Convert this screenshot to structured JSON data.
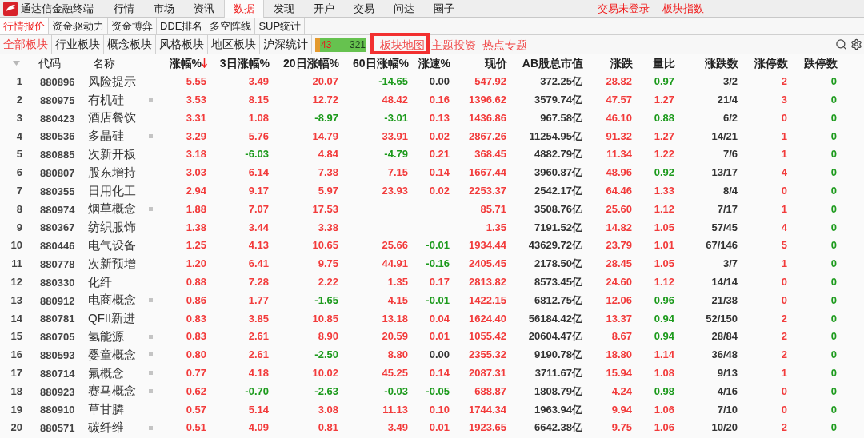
{
  "app": {
    "title": "通达信金融终端"
  },
  "menu": [
    {
      "label": "行情",
      "selected": false
    },
    {
      "label": "市场",
      "selected": false
    },
    {
      "label": "资讯",
      "selected": false
    },
    {
      "label": "数据",
      "selected": true
    },
    {
      "label": "发现",
      "selected": false
    },
    {
      "label": "开户",
      "selected": false
    },
    {
      "label": "交易",
      "selected": false
    },
    {
      "label": "问达",
      "selected": false
    },
    {
      "label": "圈子",
      "selected": false
    }
  ],
  "status_links": [
    "交易未登录",
    "板块指数"
  ],
  "sub_tabs": [
    {
      "label": "行情报价",
      "selected": true
    },
    {
      "label": "资金驱动力",
      "selected": false
    },
    {
      "label": "资金博弈",
      "selected": false
    },
    {
      "label": "DDE排名",
      "selected": false
    },
    {
      "label": "多空阵线",
      "selected": false
    },
    {
      "label": "SUP统计",
      "selected": false
    }
  ],
  "sector_tabs": [
    {
      "label": "全部板块",
      "selected": true
    },
    {
      "label": "行业板块",
      "selected": false
    },
    {
      "label": "概念板块",
      "selected": false
    },
    {
      "label": "风格板块",
      "selected": false
    },
    {
      "label": "地区板块",
      "selected": false
    },
    {
      "label": "沪深统计",
      "selected": false
    }
  ],
  "breadth_bar": {
    "left_count": "43",
    "right_count": "321",
    "level": 0.1
  },
  "feature_links": [
    {
      "label": "板块地图",
      "highlighted": true
    },
    {
      "label": "主题投资",
      "highlighted": false
    },
    {
      "label": "热点专题",
      "highlighted": false
    }
  ],
  "table": {
    "columns": [
      {
        "label": "代码",
        "kind": "code",
        "sorted": false
      },
      {
        "label": "名称",
        "kind": "name",
        "sorted": false
      },
      {
        "label": "涨幅%",
        "kind": "number",
        "sorted": true
      },
      {
        "label": "3日涨幅%",
        "kind": "number",
        "sorted": false
      },
      {
        "label": "20日涨幅%",
        "kind": "number",
        "sorted": false
      },
      {
        "label": "60日涨幅%",
        "kind": "number",
        "sorted": false
      },
      {
        "label": "涨速%",
        "kind": "number",
        "sorted": false
      },
      {
        "label": "现价",
        "kind": "number",
        "sorted": false
      },
      {
        "label": "AB股总市值",
        "kind": "number",
        "sorted": false
      },
      {
        "label": "涨跌",
        "kind": "number",
        "sorted": false
      },
      {
        "label": "量比",
        "kind": "number",
        "sorted": false
      },
      {
        "label": "涨跌数",
        "kind": "number",
        "sorted": false
      },
      {
        "label": "涨停数",
        "kind": "number",
        "sorted": false
      },
      {
        "label": "跌停数",
        "kind": "number",
        "sorted": false
      }
    ],
    "rows": [
      {
        "index": "1",
        "marked": false,
        "cells": [
          {
            "text": "880896"
          },
          {
            "text": "风险提示"
          },
          {
            "text": "5.55",
            "color": "#f23b3b"
          },
          {
            "text": "3.49",
            "color": "#f23b3b"
          },
          {
            "text": "20.07",
            "color": "#f23b3b"
          },
          {
            "text": "-14.65",
            "color": "#1c9a1c"
          },
          {
            "text": "0.00",
            "color": "#333333"
          },
          {
            "text": "547.92",
            "color": "#f23b3b"
          },
          {
            "text": "372.25亿",
            "color": "#333333"
          },
          {
            "text": "28.82",
            "color": "#f23b3b"
          },
          {
            "text": "0.97",
            "color": "#1c9a1c"
          },
          {
            "text": "3/2",
            "color": "#333333"
          },
          {
            "text": "2",
            "color": "#f23b3b"
          },
          {
            "text": "0",
            "color": "#1c9a1c"
          }
        ]
      },
      {
        "index": "2",
        "marked": true,
        "cells": [
          {
            "text": "880975"
          },
          {
            "text": "有机硅"
          },
          {
            "text": "3.53",
            "color": "#f23b3b"
          },
          {
            "text": "8.15",
            "color": "#f23b3b"
          },
          {
            "text": "12.72",
            "color": "#f23b3b"
          },
          {
            "text": "48.42",
            "color": "#f23b3b"
          },
          {
            "text": "0.16",
            "color": "#f23b3b"
          },
          {
            "text": "1396.62",
            "color": "#f23b3b"
          },
          {
            "text": "3579.74亿",
            "color": "#333333"
          },
          {
            "text": "47.57",
            "color": "#f23b3b"
          },
          {
            "text": "1.27",
            "color": "#f23b3b"
          },
          {
            "text": "21/4",
            "color": "#333333"
          },
          {
            "text": "3",
            "color": "#f23b3b"
          },
          {
            "text": "0",
            "color": "#1c9a1c"
          }
        ]
      },
      {
        "index": "3",
        "marked": false,
        "cells": [
          {
            "text": "880423"
          },
          {
            "text": "酒店餐饮"
          },
          {
            "text": "3.31",
            "color": "#f23b3b"
          },
          {
            "text": "1.08",
            "color": "#f23b3b"
          },
          {
            "text": "-8.97",
            "color": "#1c9a1c"
          },
          {
            "text": "-3.01",
            "color": "#1c9a1c"
          },
          {
            "text": "0.13",
            "color": "#f23b3b"
          },
          {
            "text": "1436.86",
            "color": "#f23b3b"
          },
          {
            "text": "967.58亿",
            "color": "#333333"
          },
          {
            "text": "46.10",
            "color": "#f23b3b"
          },
          {
            "text": "0.88",
            "color": "#1c9a1c"
          },
          {
            "text": "6/2",
            "color": "#333333"
          },
          {
            "text": "0",
            "color": "#f23b3b"
          },
          {
            "text": "0",
            "color": "#1c9a1c"
          }
        ]
      },
      {
        "index": "4",
        "marked": true,
        "cells": [
          {
            "text": "880536"
          },
          {
            "text": "多晶硅"
          },
          {
            "text": "3.29",
            "color": "#f23b3b"
          },
          {
            "text": "5.76",
            "color": "#f23b3b"
          },
          {
            "text": "14.79",
            "color": "#f23b3b"
          },
          {
            "text": "33.91",
            "color": "#f23b3b"
          },
          {
            "text": "0.02",
            "color": "#f23b3b"
          },
          {
            "text": "2867.26",
            "color": "#f23b3b"
          },
          {
            "text": "11254.95亿",
            "color": "#333333"
          },
          {
            "text": "91.32",
            "color": "#f23b3b"
          },
          {
            "text": "1.27",
            "color": "#f23b3b"
          },
          {
            "text": "14/21",
            "color": "#333333"
          },
          {
            "text": "1",
            "color": "#f23b3b"
          },
          {
            "text": "0",
            "color": "#1c9a1c"
          }
        ]
      },
      {
        "index": "5",
        "marked": false,
        "cells": [
          {
            "text": "880885"
          },
          {
            "text": "次新开板"
          },
          {
            "text": "3.18",
            "color": "#f23b3b"
          },
          {
            "text": "-6.03",
            "color": "#1c9a1c"
          },
          {
            "text": "4.84",
            "color": "#f23b3b"
          },
          {
            "text": "-4.79",
            "color": "#1c9a1c"
          },
          {
            "text": "0.21",
            "color": "#f23b3b"
          },
          {
            "text": "368.45",
            "color": "#f23b3b"
          },
          {
            "text": "4882.79亿",
            "color": "#333333"
          },
          {
            "text": "11.34",
            "color": "#f23b3b"
          },
          {
            "text": "1.22",
            "color": "#f23b3b"
          },
          {
            "text": "7/6",
            "color": "#333333"
          },
          {
            "text": "1",
            "color": "#f23b3b"
          },
          {
            "text": "0",
            "color": "#1c9a1c"
          }
        ]
      },
      {
        "index": "6",
        "marked": false,
        "cells": [
          {
            "text": "880807"
          },
          {
            "text": "股东增持"
          },
          {
            "text": "3.03",
            "color": "#f23b3b"
          },
          {
            "text": "6.14",
            "color": "#f23b3b"
          },
          {
            "text": "7.38",
            "color": "#f23b3b"
          },
          {
            "text": "7.15",
            "color": "#f23b3b"
          },
          {
            "text": "0.14",
            "color": "#f23b3b"
          },
          {
            "text": "1667.44",
            "color": "#f23b3b"
          },
          {
            "text": "3960.87亿",
            "color": "#333333"
          },
          {
            "text": "48.96",
            "color": "#f23b3b"
          },
          {
            "text": "0.92",
            "color": "#1c9a1c"
          },
          {
            "text": "13/17",
            "color": "#333333"
          },
          {
            "text": "4",
            "color": "#f23b3b"
          },
          {
            "text": "0",
            "color": "#1c9a1c"
          }
        ]
      },
      {
        "index": "7",
        "marked": false,
        "cells": [
          {
            "text": "880355"
          },
          {
            "text": "日用化工"
          },
          {
            "text": "2.94",
            "color": "#f23b3b"
          },
          {
            "text": "9.17",
            "color": "#f23b3b"
          },
          {
            "text": "5.97",
            "color": "#f23b3b"
          },
          {
            "text": "23.93",
            "color": "#f23b3b"
          },
          {
            "text": "0.02",
            "color": "#f23b3b"
          },
          {
            "text": "2253.37",
            "color": "#f23b3b"
          },
          {
            "text": "2542.17亿",
            "color": "#333333"
          },
          {
            "text": "64.46",
            "color": "#f23b3b"
          },
          {
            "text": "1.33",
            "color": "#f23b3b"
          },
          {
            "text": "8/4",
            "color": "#333333"
          },
          {
            "text": "0",
            "color": "#f23b3b"
          },
          {
            "text": "0",
            "color": "#1c9a1c"
          }
        ]
      },
      {
        "index": "8",
        "marked": true,
        "cells": [
          {
            "text": "880974"
          },
          {
            "text": "烟草概念"
          },
          {
            "text": "1.88",
            "color": "#f23b3b"
          },
          {
            "text": "7.07",
            "color": "#f23b3b"
          },
          {
            "text": "17.53",
            "color": "#f23b3b"
          },
          null,
          null,
          {
            "text": "85.71",
            "color": "#f23b3b"
          },
          {
            "text": "3508.76亿",
            "color": "#333333"
          },
          {
            "text": "25.60",
            "color": "#f23b3b"
          },
          {
            "text": "1.12",
            "color": "#f23b3b"
          },
          {
            "text": "7/17",
            "color": "#333333"
          },
          {
            "text": "1",
            "color": "#f23b3b"
          },
          {
            "text": "0",
            "color": "#1c9a1c"
          }
        ]
      },
      {
        "index": "9",
        "marked": false,
        "cells": [
          {
            "text": "880367"
          },
          {
            "text": "纺织服饰"
          },
          {
            "text": "1.38",
            "color": "#f23b3b"
          },
          {
            "text": "3.44",
            "color": "#f23b3b"
          },
          {
            "text": "3.38",
            "color": "#f23b3b"
          },
          null,
          null,
          {
            "text": "1.35",
            "color": "#f23b3b"
          },
          {
            "text": "7191.52亿",
            "color": "#333333"
          },
          {
            "text": "14.82",
            "color": "#f23b3b"
          },
          {
            "text": "1.05",
            "color": "#f23b3b"
          },
          {
            "text": "57/45",
            "color": "#333333"
          },
          {
            "text": "4",
            "color": "#f23b3b"
          },
          {
            "text": "0",
            "color": "#1c9a1c"
          }
        ]
      },
      {
        "index": "10",
        "marked": false,
        "cells": [
          {
            "text": "880446"
          },
          {
            "text": "电气设备"
          },
          {
            "text": "1.25",
            "color": "#f23b3b"
          },
          {
            "text": "4.13",
            "color": "#f23b3b"
          },
          {
            "text": "10.65",
            "color": "#f23b3b"
          },
          {
            "text": "25.66",
            "color": "#f23b3b"
          },
          {
            "text": "-0.01",
            "color": "#1c9a1c"
          },
          {
            "text": "1934.44",
            "color": "#f23b3b"
          },
          {
            "text": "43629.72亿",
            "color": "#333333"
          },
          {
            "text": "23.79",
            "color": "#f23b3b"
          },
          {
            "text": "1.01",
            "color": "#f23b3b"
          },
          {
            "text": "67/146",
            "color": "#333333"
          },
          {
            "text": "5",
            "color": "#f23b3b"
          },
          {
            "text": "0",
            "color": "#1c9a1c"
          }
        ]
      },
      {
        "index": "11",
        "marked": false,
        "cells": [
          {
            "text": "880778"
          },
          {
            "text": "次新预增"
          },
          {
            "text": "1.20",
            "color": "#f23b3b"
          },
          {
            "text": "6.41",
            "color": "#f23b3b"
          },
          {
            "text": "9.75",
            "color": "#f23b3b"
          },
          {
            "text": "44.91",
            "color": "#f23b3b"
          },
          {
            "text": "-0.16",
            "color": "#1c9a1c"
          },
          {
            "text": "2405.45",
            "color": "#f23b3b"
          },
          {
            "text": "2178.50亿",
            "color": "#333333"
          },
          {
            "text": "28.45",
            "color": "#f23b3b"
          },
          {
            "text": "1.05",
            "color": "#f23b3b"
          },
          {
            "text": "3/7",
            "color": "#333333"
          },
          {
            "text": "1",
            "color": "#f23b3b"
          },
          {
            "text": "0",
            "color": "#1c9a1c"
          }
        ]
      },
      {
        "index": "12",
        "marked": false,
        "cells": [
          {
            "text": "880330"
          },
          {
            "text": "化纤"
          },
          {
            "text": "0.88",
            "color": "#f23b3b"
          },
          {
            "text": "7.28",
            "color": "#f23b3b"
          },
          {
            "text": "2.22",
            "color": "#f23b3b"
          },
          {
            "text": "1.35",
            "color": "#f23b3b"
          },
          {
            "text": "0.17",
            "color": "#f23b3b"
          },
          {
            "text": "2813.82",
            "color": "#f23b3b"
          },
          {
            "text": "8573.45亿",
            "color": "#333333"
          },
          {
            "text": "24.60",
            "color": "#f23b3b"
          },
          {
            "text": "1.12",
            "color": "#f23b3b"
          },
          {
            "text": "14/14",
            "color": "#333333"
          },
          {
            "text": "0",
            "color": "#f23b3b"
          },
          {
            "text": "0",
            "color": "#1c9a1c"
          }
        ]
      },
      {
        "index": "13",
        "marked": true,
        "cells": [
          {
            "text": "880912"
          },
          {
            "text": "电商概念"
          },
          {
            "text": "0.86",
            "color": "#f23b3b"
          },
          {
            "text": "1.77",
            "color": "#f23b3b"
          },
          {
            "text": "-1.65",
            "color": "#1c9a1c"
          },
          {
            "text": "4.15",
            "color": "#f23b3b"
          },
          {
            "text": "-0.01",
            "color": "#1c9a1c"
          },
          {
            "text": "1422.15",
            "color": "#f23b3b"
          },
          {
            "text": "6812.75亿",
            "color": "#333333"
          },
          {
            "text": "12.06",
            "color": "#f23b3b"
          },
          {
            "text": "0.96",
            "color": "#1c9a1c"
          },
          {
            "text": "21/38",
            "color": "#333333"
          },
          {
            "text": "0",
            "color": "#f23b3b"
          },
          {
            "text": "0",
            "color": "#1c9a1c"
          }
        ]
      },
      {
        "index": "14",
        "marked": false,
        "cells": [
          {
            "text": "880781"
          },
          {
            "text": "QFII新进"
          },
          {
            "text": "0.83",
            "color": "#f23b3b"
          },
          {
            "text": "3.85",
            "color": "#f23b3b"
          },
          {
            "text": "10.85",
            "color": "#f23b3b"
          },
          {
            "text": "13.18",
            "color": "#f23b3b"
          },
          {
            "text": "0.04",
            "color": "#f23b3b"
          },
          {
            "text": "1624.40",
            "color": "#f23b3b"
          },
          {
            "text": "56184.42亿",
            "color": "#333333"
          },
          {
            "text": "13.37",
            "color": "#f23b3b"
          },
          {
            "text": "0.94",
            "color": "#1c9a1c"
          },
          {
            "text": "52/150",
            "color": "#333333"
          },
          {
            "text": "2",
            "color": "#f23b3b"
          },
          {
            "text": "0",
            "color": "#1c9a1c"
          }
        ]
      },
      {
        "index": "15",
        "marked": true,
        "cells": [
          {
            "text": "880705"
          },
          {
            "text": "氢能源"
          },
          {
            "text": "0.83",
            "color": "#f23b3b"
          },
          {
            "text": "2.61",
            "color": "#f23b3b"
          },
          {
            "text": "8.90",
            "color": "#f23b3b"
          },
          {
            "text": "20.59",
            "color": "#f23b3b"
          },
          {
            "text": "0.01",
            "color": "#f23b3b"
          },
          {
            "text": "1055.42",
            "color": "#f23b3b"
          },
          {
            "text": "20604.47亿",
            "color": "#333333"
          },
          {
            "text": "8.67",
            "color": "#f23b3b"
          },
          {
            "text": "0.94",
            "color": "#1c9a1c"
          },
          {
            "text": "28/84",
            "color": "#333333"
          },
          {
            "text": "2",
            "color": "#f23b3b"
          },
          {
            "text": "0",
            "color": "#1c9a1c"
          }
        ]
      },
      {
        "index": "16",
        "marked": true,
        "cells": [
          {
            "text": "880593"
          },
          {
            "text": "婴童概念"
          },
          {
            "text": "0.80",
            "color": "#f23b3b"
          },
          {
            "text": "2.61",
            "color": "#f23b3b"
          },
          {
            "text": "-2.50",
            "color": "#1c9a1c"
          },
          {
            "text": "8.80",
            "color": "#f23b3b"
          },
          {
            "text": "0.00",
            "color": "#333333"
          },
          {
            "text": "2355.32",
            "color": "#f23b3b"
          },
          {
            "text": "9190.78亿",
            "color": "#333333"
          },
          {
            "text": "18.80",
            "color": "#f23b3b"
          },
          {
            "text": "1.14",
            "color": "#f23b3b"
          },
          {
            "text": "36/48",
            "color": "#333333"
          },
          {
            "text": "2",
            "color": "#f23b3b"
          },
          {
            "text": "0",
            "color": "#1c9a1c"
          }
        ]
      },
      {
        "index": "17",
        "marked": true,
        "cells": [
          {
            "text": "880714"
          },
          {
            "text": "氟概念"
          },
          {
            "text": "0.77",
            "color": "#f23b3b"
          },
          {
            "text": "4.18",
            "color": "#f23b3b"
          },
          {
            "text": "10.02",
            "color": "#f23b3b"
          },
          {
            "text": "45.25",
            "color": "#f23b3b"
          },
          {
            "text": "0.14",
            "color": "#f23b3b"
          },
          {
            "text": "2087.31",
            "color": "#f23b3b"
          },
          {
            "text": "3711.67亿",
            "color": "#333333"
          },
          {
            "text": "15.94",
            "color": "#f23b3b"
          },
          {
            "text": "1.08",
            "color": "#f23b3b"
          },
          {
            "text": "9/13",
            "color": "#333333"
          },
          {
            "text": "1",
            "color": "#f23b3b"
          },
          {
            "text": "0",
            "color": "#1c9a1c"
          }
        ]
      },
      {
        "index": "18",
        "marked": true,
        "cells": [
          {
            "text": "880923"
          },
          {
            "text": "赛马概念"
          },
          {
            "text": "0.62",
            "color": "#f23b3b"
          },
          {
            "text": "-0.70",
            "color": "#1c9a1c"
          },
          {
            "text": "-2.63",
            "color": "#1c9a1c"
          },
          {
            "text": "-0.03",
            "color": "#1c9a1c"
          },
          {
            "text": "-0.05",
            "color": "#1c9a1c"
          },
          {
            "text": "688.87",
            "color": "#f23b3b"
          },
          {
            "text": "1808.79亿",
            "color": "#333333"
          },
          {
            "text": "4.24",
            "color": "#f23b3b"
          },
          {
            "text": "0.98",
            "color": "#1c9a1c"
          },
          {
            "text": "4/16",
            "color": "#333333"
          },
          {
            "text": "0",
            "color": "#f23b3b"
          },
          {
            "text": "0",
            "color": "#1c9a1c"
          }
        ]
      },
      {
        "index": "19",
        "marked": false,
        "cells": [
          {
            "text": "880910"
          },
          {
            "text": "草甘膦"
          },
          {
            "text": "0.57",
            "color": "#f23b3b"
          },
          {
            "text": "5.14",
            "color": "#f23b3b"
          },
          {
            "text": "3.08",
            "color": "#f23b3b"
          },
          {
            "text": "11.13",
            "color": "#f23b3b"
          },
          {
            "text": "0.10",
            "color": "#f23b3b"
          },
          {
            "text": "1744.34",
            "color": "#f23b3b"
          },
          {
            "text": "1963.94亿",
            "color": "#333333"
          },
          {
            "text": "9.94",
            "color": "#f23b3b"
          },
          {
            "text": "1.06",
            "color": "#f23b3b"
          },
          {
            "text": "7/10",
            "color": "#333333"
          },
          {
            "text": "0",
            "color": "#f23b3b"
          },
          {
            "text": "0",
            "color": "#1c9a1c"
          }
        ]
      },
      {
        "index": "20",
        "marked": true,
        "cells": [
          {
            "text": "880571"
          },
          {
            "text": "碳纤维"
          },
          {
            "text": "0.51",
            "color": "#f23b3b"
          },
          {
            "text": "4.09",
            "color": "#f23b3b"
          },
          {
            "text": "0.81",
            "color": "#f23b3b"
          },
          {
            "text": "3.49",
            "color": "#f23b3b"
          },
          {
            "text": "0.01",
            "color": "#f23b3b"
          },
          {
            "text": "1923.65",
            "color": "#f23b3b"
          },
          {
            "text": "6642.38亿",
            "color": "#333333"
          },
          {
            "text": "9.75",
            "color": "#f23b3b"
          },
          {
            "text": "1.06",
            "color": "#f23b3b"
          },
          {
            "text": "10/20",
            "color": "#333333"
          },
          {
            "text": "2",
            "color": "#f23b3b"
          },
          {
            "text": "0",
            "color": "#1c9a1c"
          }
        ]
      }
    ]
  }
}
